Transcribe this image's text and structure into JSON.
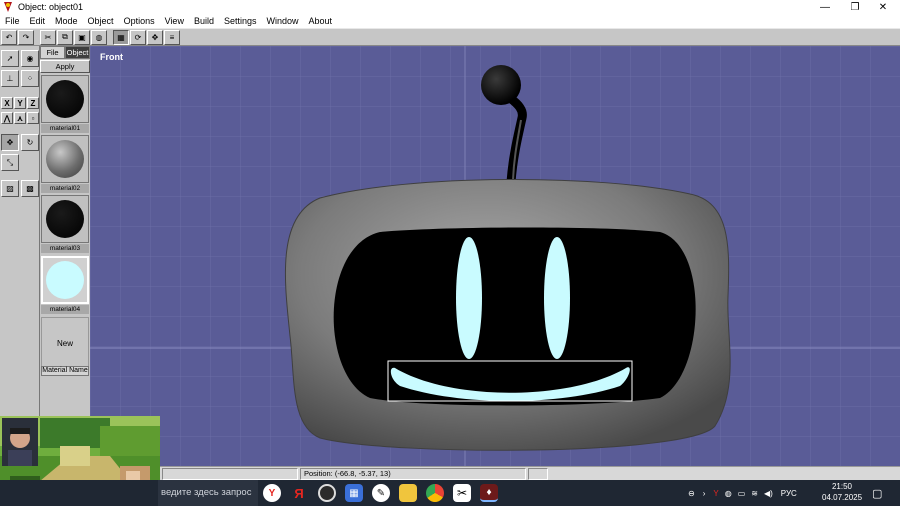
{
  "window": {
    "title": "Object: object01",
    "controls": [
      "minimize-icon",
      "restore-icon",
      "close-icon"
    ]
  },
  "menu": [
    "File",
    "Edit",
    "Mode",
    "Object",
    "Options",
    "View",
    "Build",
    "Settings",
    "Window",
    "About"
  ],
  "toolbar": {
    "buttons": [
      "undo-icon",
      "redo-icon",
      "cut-icon",
      "copy-icon",
      "paste-icon",
      "sphere-icon",
      "grid-icon",
      "rotate-icon",
      "scale-icon",
      "list-icon"
    ]
  },
  "tools": {
    "axes": [
      "X",
      "Y",
      "Z"
    ]
  },
  "material_panel": {
    "tabs": [
      "File",
      "Object"
    ],
    "apply_label": "Apply",
    "materials": [
      {
        "name": "material01",
        "color": "#000000"
      },
      {
        "name": "material02",
        "color": "#7a7a7a"
      },
      {
        "name": "material03",
        "color": "#000000"
      },
      {
        "name": "material04",
        "color": "#c9fbff"
      }
    ],
    "new_label": "New",
    "material_name_label": "Material Name"
  },
  "viewport": {
    "label": "Front",
    "background": "#5a5c97"
  },
  "status": {
    "position": "Position: (-66.8, -5.37, 13)"
  },
  "taskbar": {
    "search_text": "ведите здесь запрос",
    "language": "РУС",
    "time": "21:50",
    "date": "04.07.2025"
  }
}
